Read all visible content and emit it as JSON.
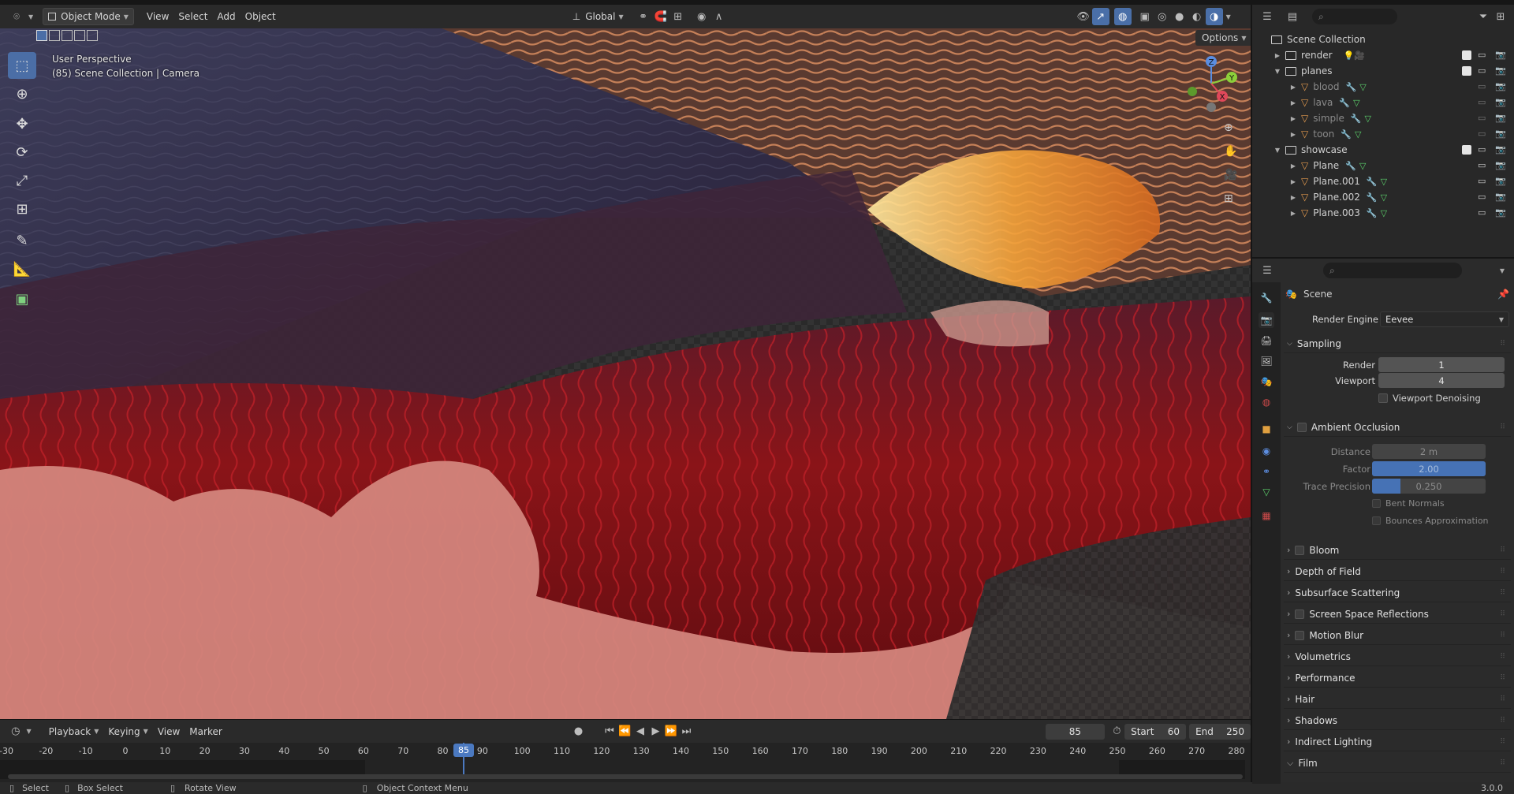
{
  "header": {
    "mode": "Object Mode",
    "menus": [
      "View",
      "Select",
      "Add",
      "Object"
    ],
    "orientation": "Global",
    "options": "Options"
  },
  "viewport": {
    "perspective": "User Perspective",
    "info": "(85) Scene Collection | Camera",
    "gizmo_axes": [
      "Z",
      "Y",
      "X"
    ]
  },
  "outliner": {
    "root": "Scene Collection",
    "items": [
      {
        "label": "render",
        "type": "collection",
        "depth": 0,
        "expanded": false
      },
      {
        "label": "planes",
        "type": "collection",
        "depth": 0,
        "expanded": true
      },
      {
        "label": "blood",
        "type": "object",
        "depth": 1,
        "dim": true
      },
      {
        "label": "lava",
        "type": "object",
        "depth": 1,
        "dim": true
      },
      {
        "label": "simple",
        "type": "object",
        "depth": 1,
        "dim": true
      },
      {
        "label": "toon",
        "type": "object",
        "depth": 1,
        "dim": true
      },
      {
        "label": "showcase",
        "type": "collection",
        "depth": 0,
        "expanded": true
      },
      {
        "label": "Plane",
        "type": "object",
        "depth": 1,
        "dim": false
      },
      {
        "label": "Plane.001",
        "type": "object",
        "depth": 1,
        "dim": false
      },
      {
        "label": "Plane.002",
        "type": "object",
        "depth": 1,
        "dim": false
      },
      {
        "label": "Plane.003",
        "type": "object",
        "depth": 1,
        "dim": false
      }
    ]
  },
  "properties": {
    "context": "Scene",
    "render_engine_label": "Render Engine",
    "render_engine": "Eevee",
    "sampling": {
      "title": "Sampling",
      "render_label": "Render",
      "render": "1",
      "viewport_label": "Viewport",
      "viewport": "4",
      "denoise": "Viewport Denoising"
    },
    "ao": {
      "title": "Ambient Occlusion",
      "distance_label": "Distance",
      "distance": "2 m",
      "factor_label": "Factor",
      "factor": "2.00",
      "factor_fill": 1.0,
      "trace_label": "Trace Precision",
      "trace": "0.250",
      "trace_fill": 0.25,
      "bent": "Bent Normals",
      "bounces": "Bounces Approximation"
    },
    "panels": [
      {
        "label": "Bloom",
        "checkbox": true
      },
      {
        "label": "Depth of Field",
        "checkbox": false
      },
      {
        "label": "Subsurface Scattering",
        "checkbox": false
      },
      {
        "label": "Screen Space Reflections",
        "checkbox": true
      },
      {
        "label": "Motion Blur",
        "checkbox": true
      },
      {
        "label": "Volumetrics",
        "checkbox": false
      },
      {
        "label": "Performance",
        "checkbox": false
      },
      {
        "label": "Hair",
        "checkbox": false
      },
      {
        "label": "Shadows",
        "checkbox": false
      },
      {
        "label": "Indirect Lighting",
        "checkbox": false
      },
      {
        "label": "Film",
        "checkbox": false,
        "expanded": true
      }
    ]
  },
  "timeline": {
    "menus": [
      "Playback",
      "Keying",
      "View",
      "Marker"
    ],
    "current_frame": "85",
    "start_label": "Start",
    "start": "60",
    "end_label": "End",
    "end": "250",
    "ruler": [
      "-30",
      "-20",
      "-10",
      "0",
      "10",
      "20",
      "30",
      "40",
      "50",
      "60",
      "70",
      "80",
      "85",
      "90",
      "100",
      "110",
      "120",
      "130",
      "140",
      "150",
      "160",
      "170",
      "180",
      "190",
      "200",
      "210",
      "220",
      "230",
      "240",
      "250",
      "260",
      "270",
      "280"
    ]
  },
  "status": {
    "select": "Select",
    "box_select": "Box Select",
    "rotate": "Rotate View",
    "context_menu": "Object Context Menu",
    "version": "3.0.0"
  }
}
